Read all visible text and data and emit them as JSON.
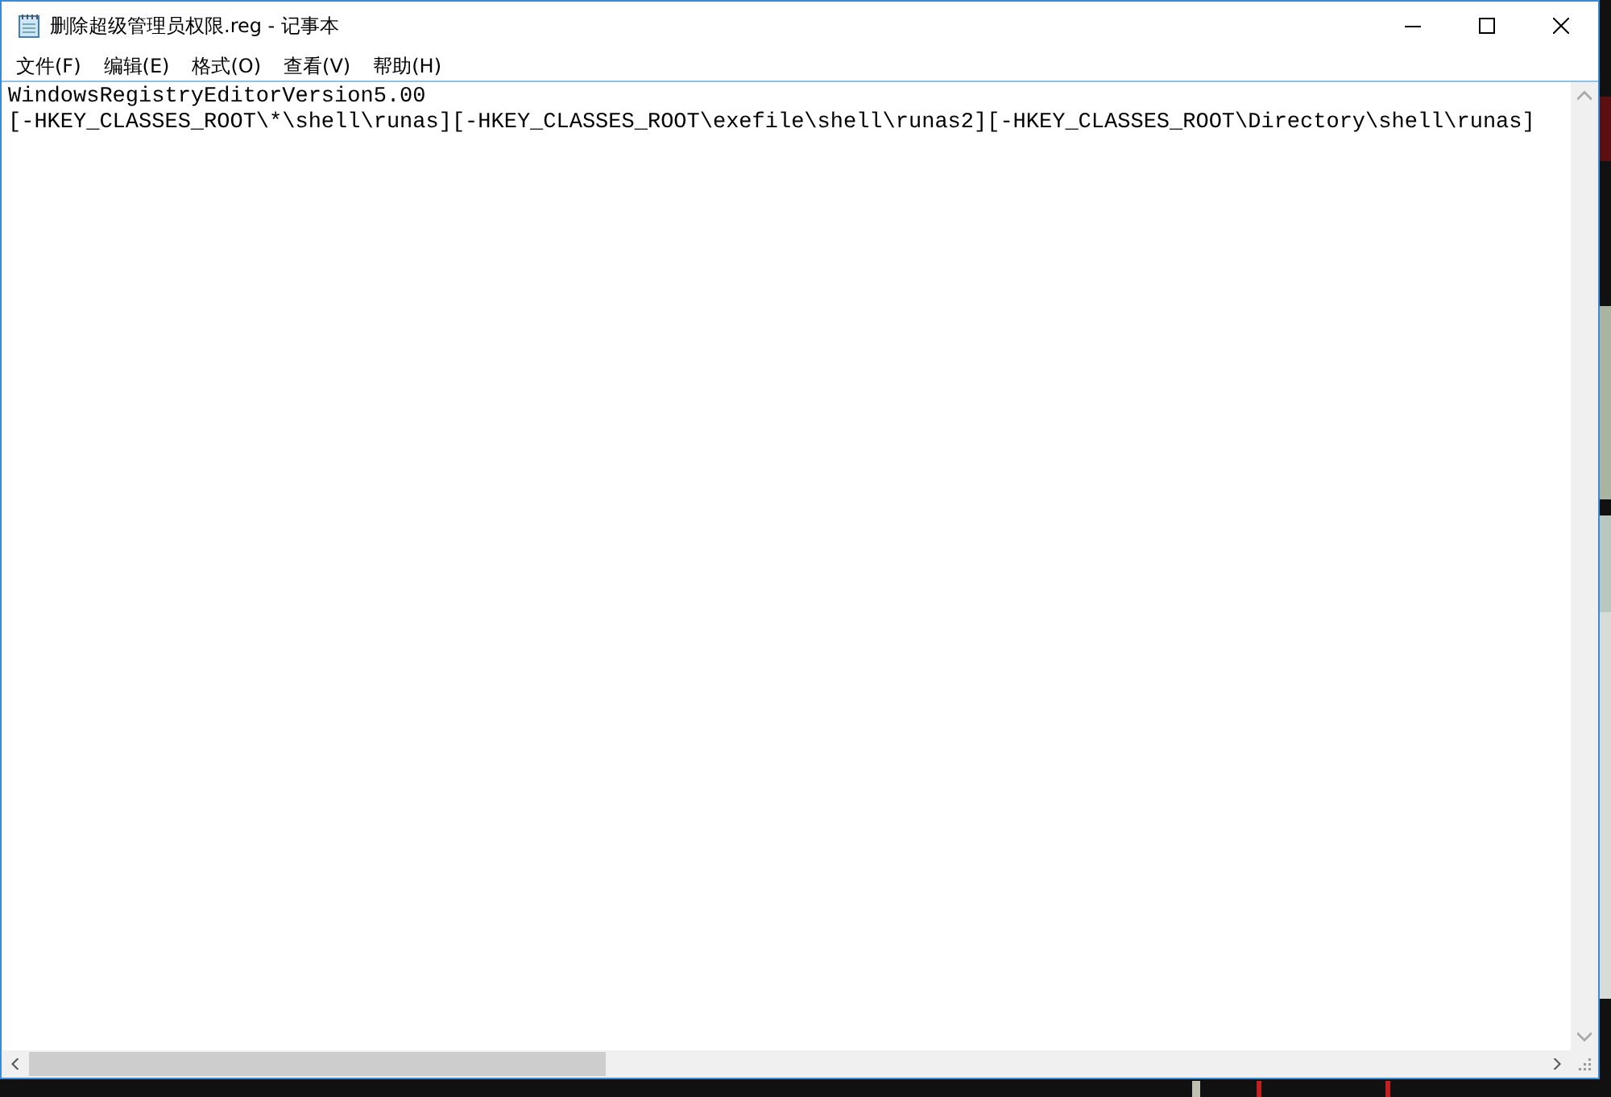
{
  "window": {
    "title": "删除超级管理员权限.reg - 记事本"
  },
  "menu": [
    {
      "label": "文件(F)"
    },
    {
      "label": "编辑(E)"
    },
    {
      "label": "格式(O)"
    },
    {
      "label": "查看(V)"
    },
    {
      "label": "帮助(H)"
    }
  ],
  "editor": {
    "lines": [
      "WindowsRegistryEditorVersion5.00",
      "[-HKEY_CLASSES_ROOT\\*\\shell\\runas][-HKEY_CLASSES_ROOT\\exefile\\shell\\runas2][-HKEY_CLASSES_ROOT\\Directory\\shell\\runas]"
    ]
  }
}
